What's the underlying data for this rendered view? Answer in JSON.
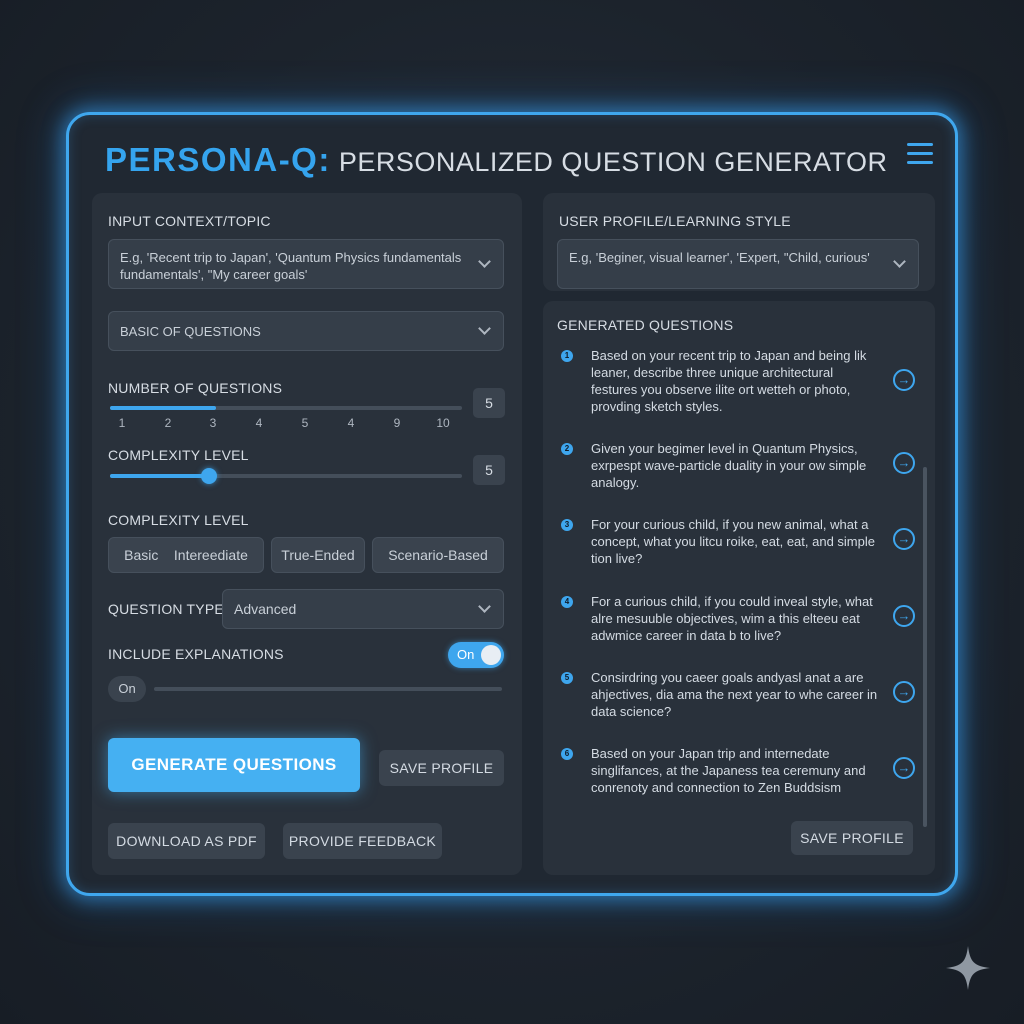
{
  "header": {
    "brand": "PERSONA-Q:",
    "subtitle": "PERSONALIZED QUESTION GENERATOR",
    "menu_icon": "hamburger-menu-icon"
  },
  "accent_color": "#3ea6ee",
  "left": {
    "input_context": {
      "label": "INPUT CONTEXT/TOPIC",
      "value": "E.g, 'Recent trip to Japan', 'Quantum Physics fundamentals fundamentals', \"My career goals'"
    },
    "basic_select": {
      "value": "BASIC  OF QUESTIONS"
    },
    "number_of_questions": {
      "label": "NUMBER OF QUESTIONS",
      "ticks": [
        "1",
        "2",
        "3",
        "4",
        "5",
        "4",
        "9",
        "10"
      ],
      "value": "5",
      "fill_fraction": 0.3
    },
    "complexity_slider": {
      "label": "COMPLEXITY LEVEL",
      "value": "5",
      "fill_fraction": 0.28
    },
    "complexity_level": {
      "label": "COMPLEXITY LEVEL",
      "options": [
        "Basic",
        "Intereediate",
        "True-Ended",
        "Scenario-Based"
      ]
    },
    "question_type": {
      "label": "QUESTION TYPE",
      "value": "Advanced"
    },
    "include_explanations": {
      "label": "INCLUDE EXPLANATIONS",
      "toggle_label": "On",
      "secondary_label": "On",
      "toggled": true
    },
    "buttons": {
      "generate": "GENERATE QUESTIONS",
      "save_profile": "SAVE PROFILE",
      "download_pdf": "DOWNLOAD AS PDF",
      "feedback": "PROVIDE FEEDBACK"
    }
  },
  "right": {
    "profile": {
      "label": "USER PROFILE/LEARNING STYLE",
      "value": "E.g, 'Beginer, visual learner', 'Expert, \"Child, curious'"
    },
    "generated": {
      "label": "GENERATED QUESTIONS",
      "questions": [
        {
          "num": "1",
          "text": "Based on your recent trip to Japan and being lik leaner, describe three unique architectural festures you observe ilite ort wetteh or photo, provding sketch styles."
        },
        {
          "num": "2",
          "text": "Given your begimer level in Quantum Physics, exrpespt wave-particle duality in your ow simple analogy."
        },
        {
          "num": "3",
          "text": "For your curious child, if you new animal, what a concept, what you litcu roike, eat, eat, and simple tion live?"
        },
        {
          "num": "4",
          "text": "For a curious child, if you could inveal style, what alre mesuuble objectives, wim a this elteeu eat adwmice career in data b to live?"
        },
        {
          "num": "5",
          "text": "Consirdring you caeer goals andyasl anat a are ahjectives, dia ama the next year to whe career in data science?"
        },
        {
          "num": "6",
          "text": "Based on your Japan trip and internedate singlifances, at the Japaness tea ceremuny and conrenoty and connection to Zen Buddsism"
        }
      ],
      "save_button": "SAVE PROFILE"
    }
  }
}
